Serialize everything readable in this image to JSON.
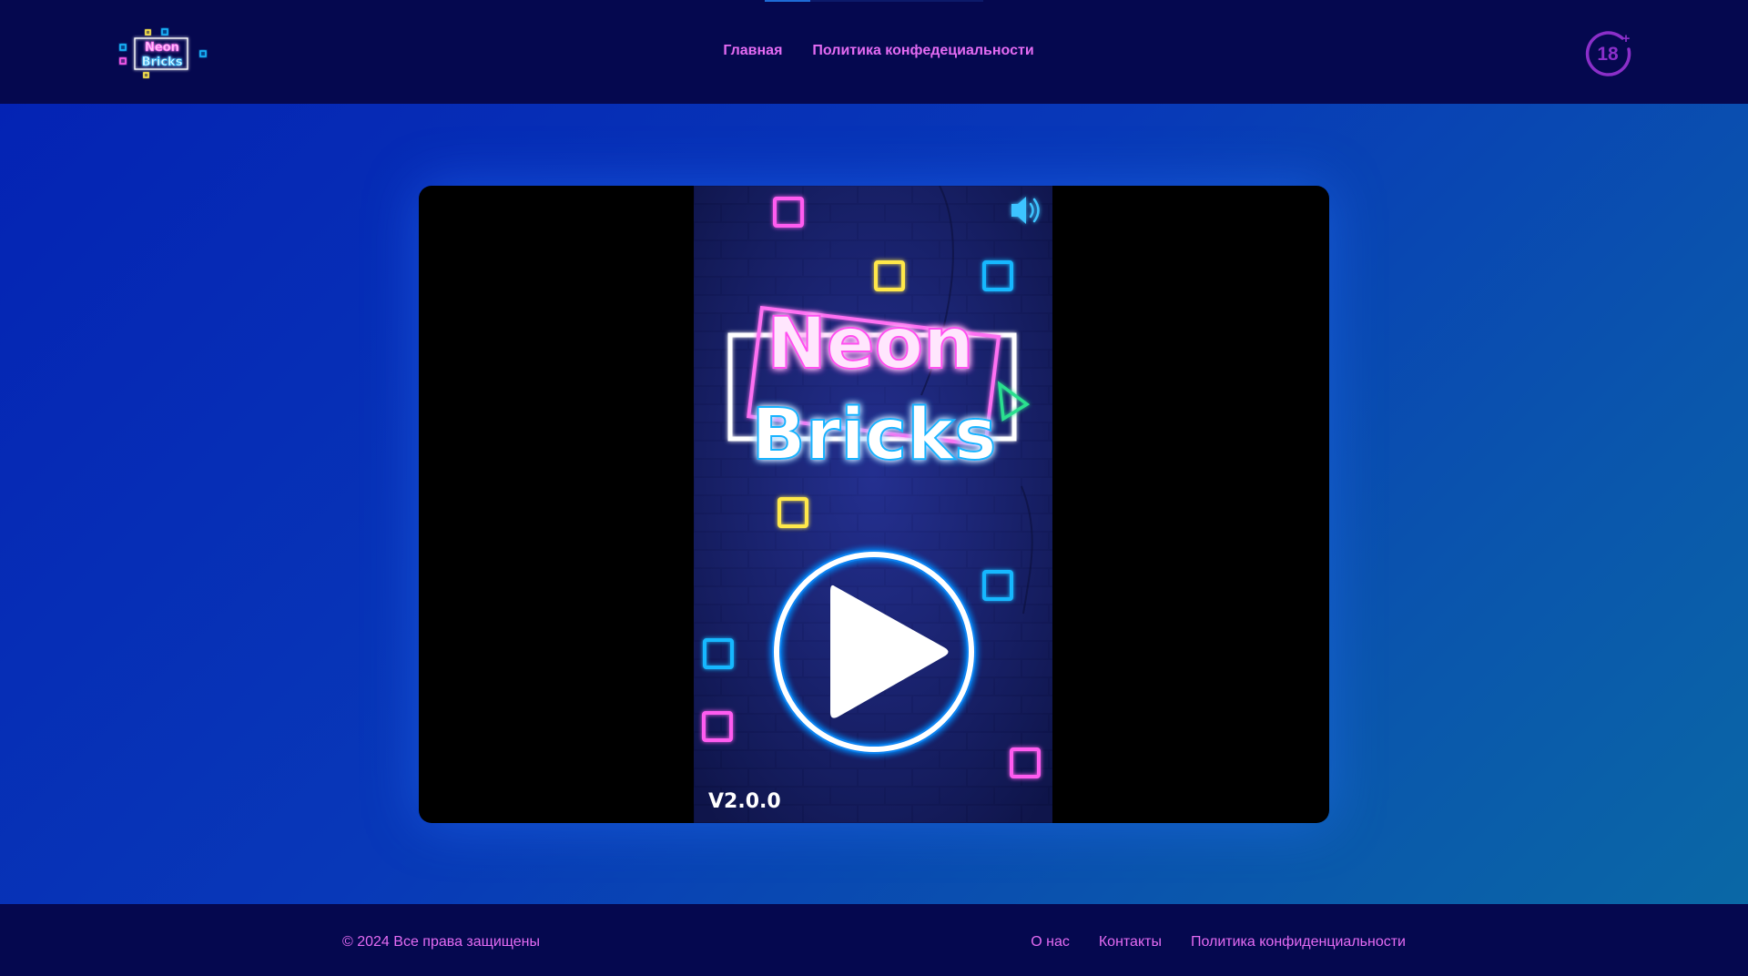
{
  "header": {
    "logo": {
      "line1": "Neon",
      "line2": "Bricks"
    },
    "nav": [
      {
        "label": "Главная"
      },
      {
        "label": "Политика конфедециальности"
      }
    ],
    "age_badge": {
      "text": "18",
      "sign": "+"
    }
  },
  "game": {
    "title_line1": "Neon",
    "title_line2": "Bricks",
    "version": "V2.0.0",
    "icons": {
      "sound": "speaker-icon",
      "play": "play-icon"
    }
  },
  "footer": {
    "copyright": "© 2024 Все права защищены",
    "links": [
      {
        "label": "О нас"
      },
      {
        "label": "Контакты"
      },
      {
        "label": "Политика конфиденциальности"
      }
    ]
  },
  "colors": {
    "header_bg": "#05084f",
    "link": "#e46bf3",
    "page_bg_start": "#0421b3",
    "page_bg_end": "#0a6aa5",
    "neon_pink": "#ff5cf0",
    "neon_cyan": "#19b8ff",
    "neon_yellow": "#ffe84a"
  }
}
